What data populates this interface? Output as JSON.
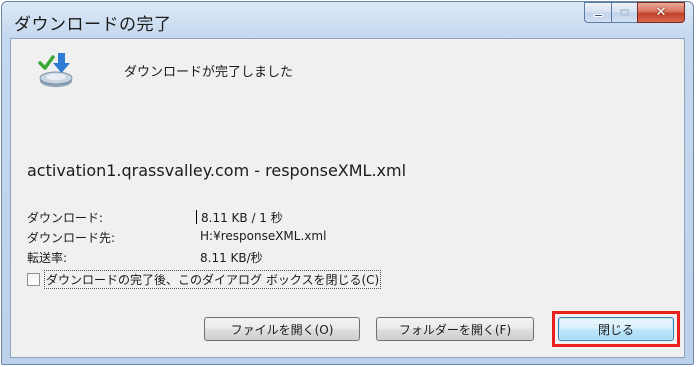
{
  "window": {
    "title": "ダウンロードの完了"
  },
  "controls": {
    "close_glyph": "✕"
  },
  "message": "ダウンロードが完了しました",
  "filename": "activation1.qrassvalley.com - responseXML.xml",
  "info": {
    "download_label": "ダウンロード:",
    "download_value": "8.11 KB / 1 秒",
    "destination_label": "ダウンロード先:",
    "destination_value": "H:¥responseXML.xml",
    "rate_label": "転送率:",
    "rate_value": "8.11 KB/秒"
  },
  "checkbox": {
    "label": "ダウンロードの完了後、このダイアログ ボックスを閉じる(C)",
    "checked": false
  },
  "buttons": {
    "open_file": "ファイルを開く(O)",
    "open_folder": "フォルダーを開く(F)",
    "close": "閉じる"
  },
  "colors": {
    "highlight": "#e8201e",
    "close_button": "#c2412a",
    "download_arrow": "#2e7bd6",
    "checkmark": "#3aa935"
  },
  "icons": {
    "download": "download-complete-icon"
  }
}
